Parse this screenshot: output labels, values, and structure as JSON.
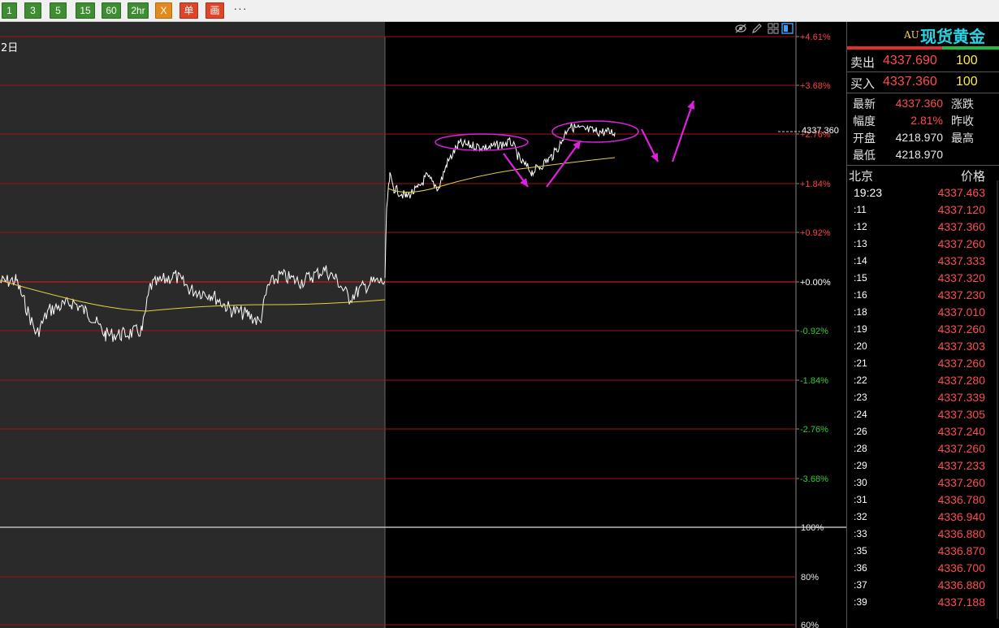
{
  "toolbar": {
    "buttons": [
      {
        "label": "1",
        "style": "green"
      },
      {
        "label": "3",
        "style": "green"
      },
      {
        "label": "5",
        "style": "green"
      },
      {
        "label": "15",
        "style": "green"
      },
      {
        "label": "60",
        "style": "green"
      },
      {
        "label": "2hr",
        "style": "green"
      },
      {
        "label": "X",
        "style": "orange"
      },
      {
        "label": "单",
        "style": "red"
      },
      {
        "label": "画",
        "style": "red"
      }
    ],
    "more": "···"
  },
  "chart": {
    "date_label": "2日",
    "last_price_marker": "4337.360",
    "icons": [
      "eye-icon",
      "pencil-icon",
      "grid-icon",
      "window-icon"
    ],
    "price_axis": {
      "ticks": [
        "+4.61%",
        "+3.68%",
        "+2.76%",
        "+1.84%",
        "+0.92%",
        "+0.00%",
        "-0.92%",
        "-1.84%",
        "-2.76%",
        "-3.68%"
      ],
      "tick_colors": [
        "#ff4040",
        "#ff4040",
        "#ff4040",
        "#ff4040",
        "#ff4040",
        "#ffffff",
        "#2fd02f",
        "#2fd02f",
        "#2fd02f",
        "#2fd02f"
      ]
    },
    "volume_axis": {
      "ticks": [
        "100%",
        "80%",
        "60%"
      ]
    },
    "colors": {
      "price_line": "#ffffff",
      "avg_line": "#e8d040",
      "grid": "#a01414",
      "annotation": "#e020e0",
      "prev_day_bg": "#2a2a2a"
    },
    "annotations": [
      "two ellipses marking consolidation zones",
      "four magenta arrows indicating down-up-down-up path"
    ]
  },
  "panel": {
    "code": "AU",
    "name": "现货黄金",
    "sell": {
      "label": "卖出",
      "price": "4337.690",
      "volume": "100"
    },
    "buy": {
      "label": "买入",
      "price": "4337.360",
      "volume": "100"
    },
    "stats": [
      {
        "label": "最新",
        "value": "4337.360",
        "value_color": "#ff4d4d",
        "right": "涨跌"
      },
      {
        "label": "幅度",
        "value": "2.81%",
        "value_color": "#ff4d4d",
        "right": "昨收"
      },
      {
        "label": "开盘",
        "value": "4218.970",
        "value_color": "#e8e8e8",
        "right": "最高"
      },
      {
        "label": "最低",
        "value": "4218.970",
        "value_color": "#e8e8e8",
        "right": ""
      }
    ],
    "ticks_header": {
      "left": "北京",
      "right": "价格"
    },
    "ticks": [
      {
        "time": "19:23",
        "price": "4337.463"
      },
      {
        "time": ":11",
        "price": "4337.120"
      },
      {
        "time": ":12",
        "price": "4337.360"
      },
      {
        "time": ":13",
        "price": "4337.260"
      },
      {
        "time": ":14",
        "price": "4337.333"
      },
      {
        "time": ":15",
        "price": "4337.320"
      },
      {
        "time": ":16",
        "price": "4337.230"
      },
      {
        "time": ":18",
        "price": "4337.010"
      },
      {
        "time": ":19",
        "price": "4337.260"
      },
      {
        "time": ":20",
        "price": "4337.303"
      },
      {
        "time": ":21",
        "price": "4337.260"
      },
      {
        "time": ":22",
        "price": "4337.280"
      },
      {
        "time": ":23",
        "price": "4337.339"
      },
      {
        "time": ":24",
        "price": "4337.305"
      },
      {
        "time": ":26",
        "price": "4337.240"
      },
      {
        "time": ":28",
        "price": "4337.260"
      },
      {
        "time": ":29",
        "price": "4337.233"
      },
      {
        "time": ":30",
        "price": "4337.260"
      },
      {
        "time": ":31",
        "price": "4336.780"
      },
      {
        "time": ":32",
        "price": "4336.940"
      },
      {
        "time": ":33",
        "price": "4336.880"
      },
      {
        "time": ":35",
        "price": "4336.870"
      },
      {
        "time": ":36",
        "price": "4336.700"
      },
      {
        "time": ":37",
        "price": "4336.880"
      },
      {
        "time": ":39",
        "price": "4337.188"
      }
    ]
  }
}
